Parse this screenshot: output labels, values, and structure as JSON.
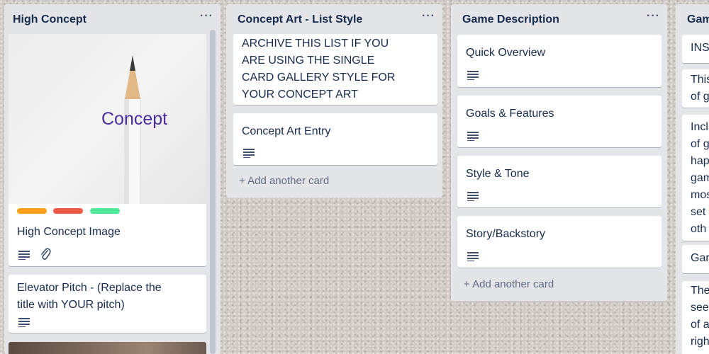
{
  "lists": [
    {
      "title": "High Concept",
      "menu": "···",
      "cards": [
        {
          "cover_text": "Concept",
          "title": "High Concept Image",
          "labels": [
            "#ff9f1a",
            "#eb5a46",
            "#51e898"
          ]
        },
        {
          "title": "Elevator Pitch - (Replace the title with YOUR pitch)"
        }
      ]
    },
    {
      "title": "Concept Art - List Style",
      "menu": "···",
      "cards": [
        {
          "title": "ARCHIVE THIS LIST IF YOU ARE USING THE SINGLE CARD GALLERY STYLE FOR YOUR CONCEPT ART"
        },
        {
          "title": "Concept Art Entry"
        }
      ],
      "add_card": "+ Add another card"
    },
    {
      "title": "Game Description",
      "menu": "···",
      "cards": [
        {
          "title": "Quick Overview"
        },
        {
          "title": "Goals & Features"
        },
        {
          "title": "Style & Tone"
        },
        {
          "title": "Story/Backstory"
        }
      ],
      "add_card": "+ Add another card"
    },
    {
      "title": "Gam",
      "cards": [
        {
          "title": "INS"
        },
        {
          "title": "This of g"
        },
        {
          "title": "Incl of g hap gam mos set oth"
        },
        {
          "title": "Gar"
        },
        {
          "title": "The see of a righ"
        }
      ]
    }
  ],
  "colors": {
    "list_bg": "#e3e5e9",
    "card_bg": "#ffffff",
    "text": "#172b4d",
    "muted": "#5e6c84",
    "cover_text": "#4b2e9c"
  },
  "icons": [
    "description-icon",
    "attachment-icon",
    "more-menu-icon"
  ]
}
